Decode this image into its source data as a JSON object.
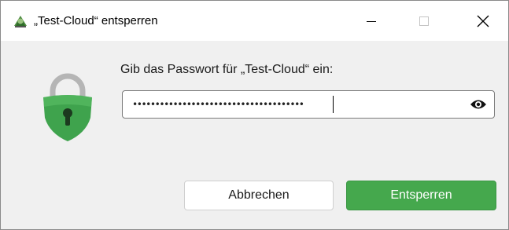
{
  "window": {
    "title": "„Test-Cloud“ entsperren",
    "controls": {
      "minimize": "minimize-icon",
      "maximize": "maximize-icon",
      "close": "close-icon"
    }
  },
  "dialog": {
    "prompt": "Gib das Passwort für „Test-Cloud“ ein:",
    "password_masked": "••••••••••••••••••••••••••••••••••••••",
    "buttons": {
      "cancel": "Abbrechen",
      "unlock": "Entsperren"
    }
  },
  "colors": {
    "accent_green": "#45a84d",
    "lock_green": "#3fa34d",
    "lock_shackle": "#b5b5b5"
  }
}
